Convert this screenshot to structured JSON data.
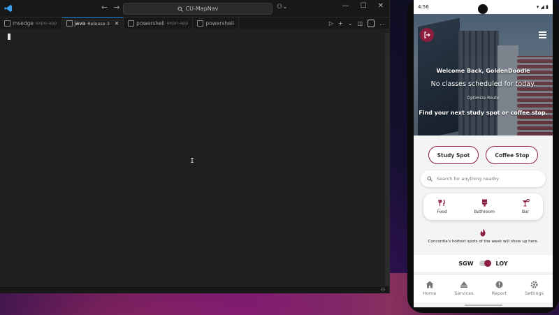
{
  "vscode": {
    "title": "CU-MapNav",
    "tabs": [
      {
        "label": "msedge",
        "sub": "expo-app"
      },
      {
        "label": "java",
        "sub": "Release 3"
      },
      {
        "label": "powershell",
        "sub": "expo-app"
      },
      {
        "label": "powershell",
        "sub": ""
      }
    ],
    "icons": {
      "nav_back": "←",
      "nav_forward": "→",
      "run": "▷",
      "add": "+",
      "more": "…"
    }
  },
  "phone": {
    "status": {
      "time": "4:56",
      "battery": "▮"
    },
    "hero": {
      "welcome": "Welcome Back, GoldenDoodle",
      "classes": "No classes scheduled for today.",
      "optimize": "Optimize Route",
      "find": "Find your next study spot or coffee stop."
    },
    "buttons": {
      "study": "Study Spot",
      "coffee": "Coffee Stop"
    },
    "search_placeholder": "Search for anything nearby",
    "categories": [
      {
        "label": "Food",
        "icon": "utensils-icon"
      },
      {
        "label": "Bathroom",
        "icon": "toilet-icon"
      },
      {
        "label": "Bar",
        "icon": "cocktail-icon"
      }
    ],
    "hot_text": "Concordia's hottest spots of the week will show up here.",
    "campus": {
      "left": "SGW",
      "right": "LOY"
    },
    "nav": [
      {
        "label": "Home",
        "icon": "home-icon"
      },
      {
        "label": "Services",
        "icon": "services-icon"
      },
      {
        "label": "Report",
        "icon": "report-icon"
      },
      {
        "label": "Settings",
        "icon": "settings-icon"
      }
    ],
    "accent": "#8c1d3f"
  }
}
